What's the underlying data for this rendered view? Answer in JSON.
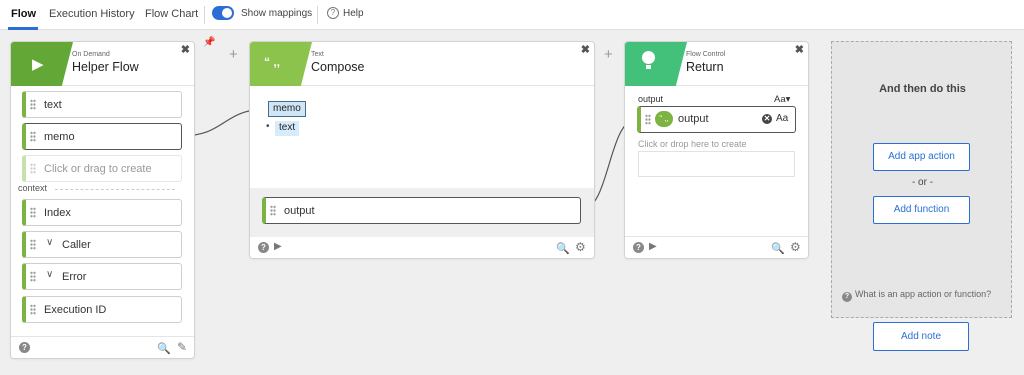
{
  "nav": {
    "tabs": [
      {
        "label": "Flow",
        "active": true
      },
      {
        "label": "Execution History",
        "active": false
      },
      {
        "label": "Flow Chart",
        "active": false
      }
    ],
    "toggle_label": "Show mappings",
    "toggle_on": true,
    "help_label": "Help"
  },
  "colors": {
    "accent_blue": "#2b6fd6",
    "trigger_green": "#63a836",
    "compose_green": "#8cc34d",
    "return_green": "#43c07a",
    "field_green": "#7cb342"
  },
  "helper_card": {
    "category": "On Demand",
    "title": "Helper Flow",
    "icon": "play-icon",
    "fields": [
      "text",
      "memo"
    ],
    "create_placeholder": "Click or drag to create",
    "context_label": "context",
    "context_fields": [
      {
        "label": "Index",
        "expandable": false
      },
      {
        "label": "Caller",
        "expandable": true
      },
      {
        "label": "Error",
        "expandable": true
      },
      {
        "label": "Execution ID",
        "expandable": false
      }
    ]
  },
  "compose_card": {
    "category": "Text",
    "title": "Compose",
    "icon": "quote-icon",
    "icon_text": "“ ,,",
    "mapped_token": "memo",
    "bullet": "•",
    "text_token": "text",
    "output_label": "output"
  },
  "return_card": {
    "category": "Flow Control",
    "title": "Return",
    "icon": "lightbulb-icon",
    "output_header": "output",
    "type_dropdown": "Aa▾",
    "badge_text": "“ ,,",
    "output_label": "output",
    "type_label": "Aa",
    "create_hint": "Click or drop here to create"
  },
  "add_panel": {
    "title": "And then do this",
    "add_app_action": "Add app action",
    "or_label": "- or -",
    "add_function": "Add function",
    "help_text": "What is an app action or function?"
  },
  "add_note": "Add note",
  "glyphs": {
    "close": "✖",
    "plus": "+",
    "pin": "📌",
    "question": "?",
    "run": "▶",
    "search": "🔍",
    "settings": "⚙",
    "edit": "✎",
    "chevron": "∨",
    "x": "✕"
  }
}
